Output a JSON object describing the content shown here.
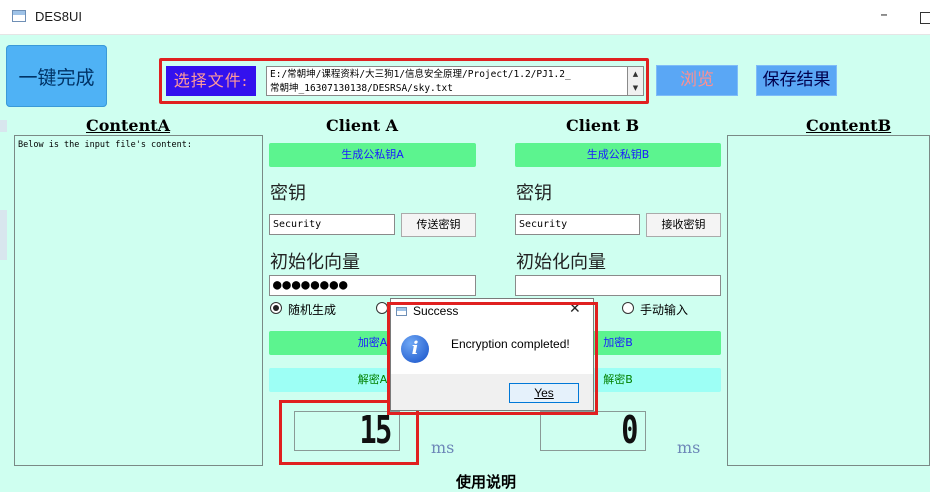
{
  "window": {
    "title": "DES8UI"
  },
  "toolbar": {
    "one_click_label": "一键完成",
    "file_label": "选择文件:",
    "file_path": "E:/常朝坤/课程资料/大三狗1/信息安全原理/Project/1.2/PJ1.2_\n常朝坤_16307130138/DESRSA/sky.txt",
    "browse_label": "浏览",
    "save_label": "保存结果"
  },
  "content_a": {
    "heading": "ContentA",
    "text": "Below is the input file's content:"
  },
  "content_b": {
    "heading": "ContentB",
    "text": ""
  },
  "client_a": {
    "heading": "Client A",
    "gen_keys_label": "生成公私钥A",
    "key_label": "密钥",
    "key_value": "Security",
    "send_key_label": "传送密钥",
    "iv_label": "初始化向量",
    "iv_value": "●●●●●●●●",
    "random_label": "随机生成",
    "encrypt_label": "加密A",
    "decrypt_label": "解密A",
    "time_value": "15",
    "time_unit": "ms"
  },
  "client_b": {
    "heading": "Client B",
    "gen_keys_label": "生成公私钥B",
    "key_label": "密钥",
    "key_value": "Security",
    "receive_key_label": "接收密钥",
    "iv_label": "初始化向量",
    "iv_value": "",
    "manual_label": "手动输入",
    "encrypt_label": "加密B",
    "decrypt_label": "解密B",
    "time_value": "0",
    "time_unit": "ms"
  },
  "dialog": {
    "title": "Success",
    "message": "Encryption completed!",
    "yes_label": "Yes",
    "close_glyph": "✕"
  },
  "footer": {
    "usage_label": "使用说明"
  },
  "colors": {
    "background": "#cffff0",
    "highlight": "#e02020",
    "green_button": "#5cf48f",
    "cyan_button": "#9dfff5",
    "blue_button": "#5aa7f5"
  }
}
